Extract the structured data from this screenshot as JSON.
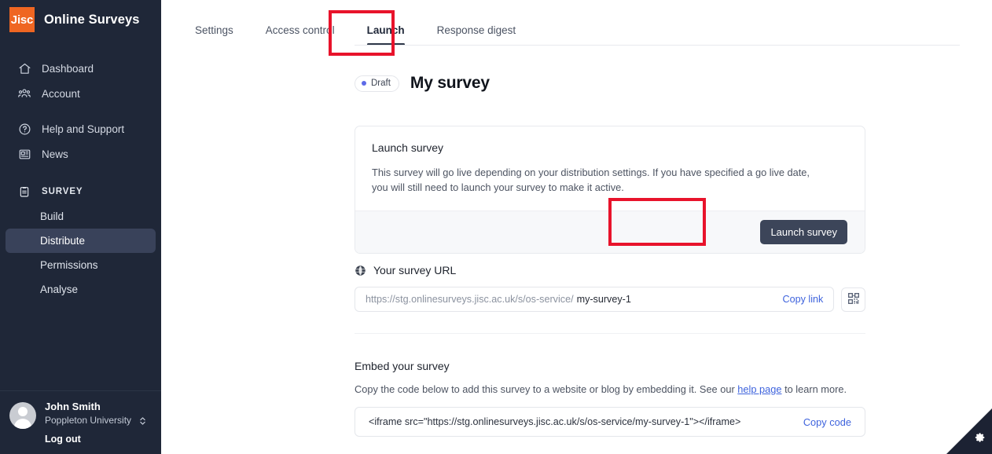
{
  "sidebar": {
    "brand": {
      "logo_text": "Jisc",
      "title": "Online Surveys"
    },
    "nav": [
      {
        "label": "Dashboard",
        "icon": "home-icon"
      },
      {
        "label": "Account",
        "icon": "people-icon"
      },
      {
        "label": "Help and Support",
        "icon": "question-circle-icon"
      },
      {
        "label": "News",
        "icon": "newspaper-icon"
      }
    ],
    "section": {
      "label": "SURVEY",
      "icon": "clipboard-icon"
    },
    "sub_items": [
      {
        "label": "Build",
        "active": false
      },
      {
        "label": "Distribute",
        "active": true
      },
      {
        "label": "Permissions",
        "active": false
      },
      {
        "label": "Analyse",
        "active": false
      }
    ],
    "footer": {
      "user_name": "John Smith",
      "organisation": "Poppleton University",
      "logout": "Log out"
    }
  },
  "tabs": [
    {
      "label": "Settings",
      "active": false
    },
    {
      "label": "Access control",
      "active": false
    },
    {
      "label": "Launch",
      "active": true
    },
    {
      "label": "Response digest",
      "active": false
    }
  ],
  "header": {
    "status_badge": "Draft",
    "title": "My survey"
  },
  "launch_card": {
    "title": "Launch survey",
    "description": "This survey will go live depending on your distribution settings. If you have specified a go live date, you will still need to launch your survey to make it active.",
    "button_label": "Launch survey"
  },
  "survey_url": {
    "heading": "Your survey URL",
    "prefix": "https://stg.onlinesurveys.jisc.ac.uk/s/os-service/",
    "slug": "my-survey-1",
    "copy_label": "Copy link",
    "qr_icon": "qr-code-icon"
  },
  "embed": {
    "title": "Embed your survey",
    "description_before": "Copy the code below to add this survey to a website or blog by embedding it. See our ",
    "link_text": "help page",
    "description_after": " to learn more.",
    "code": "<iframe src=\"https://stg.onlinesurveys.jisc.ac.uk/s/os-service/my-survey-1\"></iframe>",
    "copy_label": "Copy code"
  },
  "corner_widget": {
    "icon": "gear-icon"
  },
  "colors": {
    "sidebar_bg": "#1f2738",
    "brand_orange": "#ef6622",
    "accent_link": "#3e63dd",
    "draft_dot": "#5d6ae8",
    "annotation_red": "#e8132b",
    "button_dark": "#3c4559"
  }
}
